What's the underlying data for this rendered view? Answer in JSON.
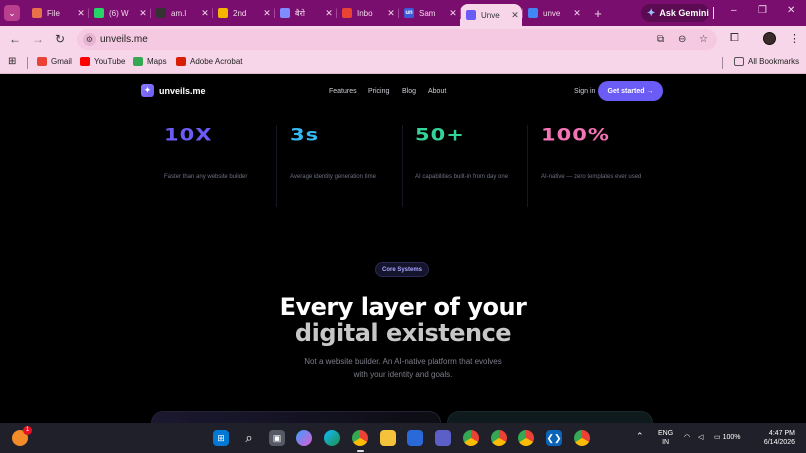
{
  "browser": {
    "tabs": [
      {
        "title": "File",
        "favicon": "figma-icon",
        "color": "#e8714a",
        "active": false
      },
      {
        "title": "(6) W",
        "favicon": "whatsapp-icon",
        "color": "#25d366",
        "active": false
      },
      {
        "title": "am.l",
        "favicon": "github-icon",
        "color": "#333333",
        "active": false
      },
      {
        "title": "2nd",
        "favicon": "drive-icon",
        "color": "#f4b400",
        "active": false
      },
      {
        "title": "बैरो",
        "favicon": "gemini-icon",
        "color": "#7e8cff",
        "active": false
      },
      {
        "title": "Inbo",
        "favicon": "gmail-icon",
        "color": "#ea4335",
        "active": false
      },
      {
        "title": "Sam",
        "favicon": "un-icon",
        "color": "#3b5bd9",
        "favicon_text": "un",
        "active": false
      },
      {
        "title": "Unve",
        "favicon": "unveils-icon",
        "color": "#6b5cf6",
        "active": true
      },
      {
        "title": "unve",
        "favicon": "google-icon",
        "color": "#4285f4",
        "active": false
      }
    ],
    "new_tab": "+",
    "gemini_label": "Ask Gemini",
    "window_controls": {
      "minimize": "–",
      "maximize": "❐",
      "close": "✕"
    },
    "address": {
      "url": "unveils.me"
    },
    "bookmarks": [
      {
        "label": "Gmail",
        "icon": "gmail-icon",
        "color": "#ea4335"
      },
      {
        "label": "YouTube",
        "icon": "youtube-icon",
        "color": "#ff0000"
      },
      {
        "label": "Maps",
        "icon": "maps-icon",
        "color": "#34a853"
      },
      {
        "label": "Adobe Acrobat",
        "icon": "acrobat-icon",
        "color": "#d81e05"
      }
    ],
    "all_bookmarks": "All Bookmarks"
  },
  "site": {
    "logo": "unveils.me",
    "nav": [
      "Features",
      "Pricing",
      "Blog",
      "About"
    ],
    "sign_in": "Sign in",
    "cta": "Get started →",
    "stats": [
      {
        "value": "10X",
        "caption": "Faster than any website builder",
        "color": "#6b5cf6"
      },
      {
        "value": "3s",
        "caption": "Average identity generation time",
        "color": "#38b8f2"
      },
      {
        "value": "50+",
        "caption": "AI capabilities built-in from day one",
        "color": "#34d399"
      },
      {
        "value": "100%",
        "caption": "AI-native — zero templates ever used",
        "color": "#f472b6"
      }
    ],
    "badge": "Core Systems",
    "headline_line1": "Every layer of your",
    "headline_line2": "digital existence",
    "subtext_line1": "Not a website builder. An AI-native platform that evolves",
    "subtext_line2": "with your identity and goals."
  },
  "taskbar": {
    "notification_count": "1",
    "apps": [
      "windows-start-icon",
      "search-icon",
      "task-view-icon",
      "copilot-icon",
      "edge-icon",
      "chrome-icon",
      "file-explorer-icon",
      "store-icon",
      "teams-icon",
      "chrome-profile-icon",
      "chrome-profile-icon",
      "chrome-profile-icon",
      "vscode-icon",
      "chrome-profile-icon"
    ],
    "language": "ENG",
    "region": "IN",
    "battery": "100%",
    "time": "4:47 PM",
    "date": "6/14/2026"
  }
}
